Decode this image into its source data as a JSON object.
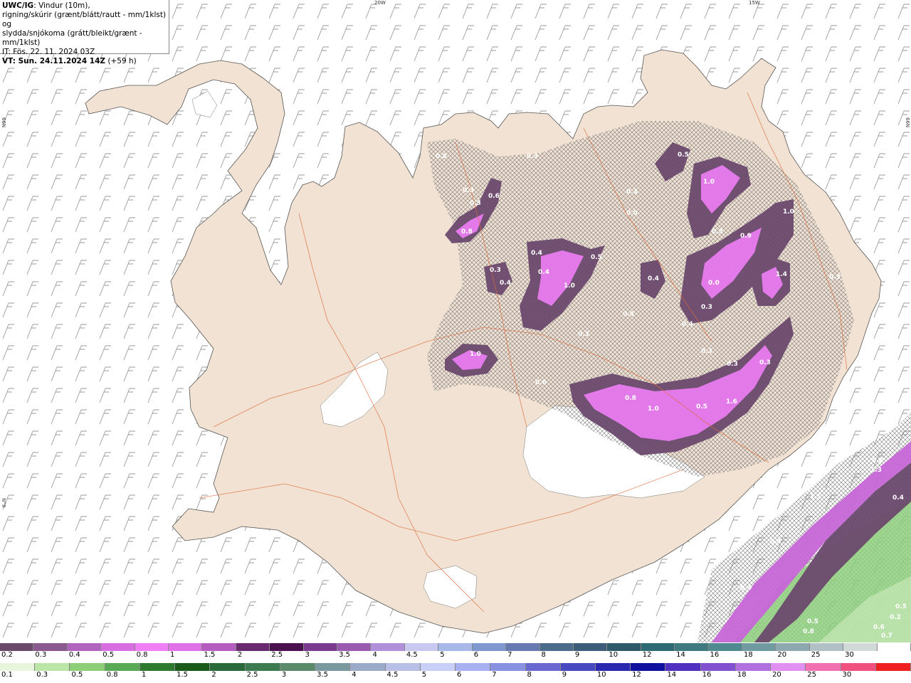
{
  "header": {
    "model": "UWC/IG",
    "desc_line1": ": Vindur (10m),",
    "desc_line2": "rigning/skúrir (grænt/blátt/rautt - mm/1klst) og",
    "desc_line3": "slydda/snjókoma (grátt/bleikt/grænt - mm/1klst)",
    "issue_time": "IT: Fös. 22. 11. 2024 03Z",
    "valid_time": "VT: Sun. 24.11.2024 14Z",
    "lead": "(+59 h)"
  },
  "grid_labels": {
    "lon1": "20W",
    "lon2": "15W",
    "lat1": "66N",
    "lat2": "66N",
    "lat3": "N°9"
  },
  "precip_labels": [
    "0.5",
    "0.3",
    "0.3",
    "0.3",
    "0.6",
    "0.3",
    "0.8",
    "1.0",
    "0.3",
    "0.0",
    "0.5",
    "1.0",
    "0.3",
    "0.9",
    "1.0",
    "0.4",
    "0.4",
    "0.3",
    "1.0",
    "0.3",
    "0.4",
    "0.4",
    "1.4",
    "0.0",
    "0.3",
    "0.4",
    "0.3",
    "0.4",
    "0.3",
    "0.3",
    "0.6",
    "0.8",
    "1.0",
    "0.5",
    "1.6",
    "0.8",
    "1.3",
    "1.5",
    "0.4",
    "0.4",
    "0.4",
    "0.5",
    "0.5",
    "0.6",
    "0.2",
    "0.7",
    "0.8",
    "0.8"
  ],
  "legend": {
    "snow": {
      "labels": [
        "0.2",
        "0.3",
        "0.4",
        "0.5",
        "0.8",
        "1",
        "1.5",
        "2",
        "2.5",
        "3",
        "3.5",
        "4",
        "4.5",
        "5",
        "6",
        "7",
        "8",
        "9",
        "10",
        "12",
        "14",
        "16",
        "18",
        "20",
        "25",
        "30"
      ],
      "colors": [
        "#6a4a6a",
        "#8a5a8e",
        "#b064c0",
        "#d86ee0",
        "#f07ef5",
        "#e070e8",
        "#b45cc0",
        "#6a2a70",
        "#4a104f",
        "#7a3a8e",
        "#9a5ab0",
        "#b090d8",
        "#c8c8f0",
        "#a8b8e8",
        "#8098d0",
        "#6878b0",
        "#4c6a8a",
        "#3c5c7a",
        "#2e5a6a",
        "#2e6a74",
        "#3e7a80",
        "#4e8a90",
        "#6e9aa0",
        "#8ea8b0",
        "#b0c0c4",
        "#d0d8d8",
        "#ffffff"
      ]
    },
    "rain": {
      "labels": [
        "0.1",
        "0.3",
        "0.5",
        "0.8",
        "1",
        "1.5",
        "2",
        "2.5",
        "3",
        "3.5",
        "4",
        "4.5",
        "5",
        "6",
        "7",
        "8",
        "9",
        "10",
        "12",
        "14",
        "16",
        "18",
        "20",
        "25",
        "30"
      ],
      "colors": [
        "#e6f5dc",
        "#bce6a8",
        "#8ccf78",
        "#5aaa55",
        "#2e7a2e",
        "#1a5a1a",
        "#2a6a3a",
        "#3e7a50",
        "#5a8a6a",
        "#7a9aa0",
        "#9aaac8",
        "#b8c0e8",
        "#c8d0f8",
        "#a8b0f0",
        "#8890e0",
        "#6868d0",
        "#4848c0",
        "#2828b0",
        "#1010a0",
        "#5030c0",
        "#8050d0",
        "#b070e0",
        "#e090f0",
        "#f070b0",
        "#f05080",
        "#f02020"
      ]
    }
  }
}
